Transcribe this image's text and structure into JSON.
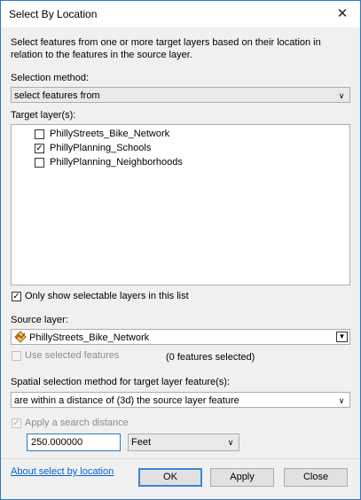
{
  "window": {
    "title": "Select By Location"
  },
  "description": "Select features from one or more target layers based on their location in relation to the features in the source layer.",
  "selection_method": {
    "label": "Selection method:",
    "value": "select features from"
  },
  "target_layers": {
    "label": "Target layer(s):",
    "items": [
      {
        "label": "PhillyStreets_Bike_Network",
        "checked": false
      },
      {
        "label": "PhillyPlanning_Schools",
        "checked": true
      },
      {
        "label": "PhillyPlanning_Neighborhoods",
        "checked": false
      }
    ]
  },
  "only_selectable": {
    "label": "Only show selectable layers in this list",
    "checked": true
  },
  "source_layer": {
    "label": "Source layer:",
    "value": "PhillyStreets_Bike_Network",
    "icon": "polyline-layer-icon"
  },
  "use_selected": {
    "label": "Use selected features",
    "checked": false,
    "count_text": "(0 features selected)"
  },
  "spatial_method": {
    "label": "Spatial selection method for target layer feature(s):",
    "value": "are within a distance of (3d) the source layer feature"
  },
  "search_distance": {
    "label": "Apply a search distance",
    "checked": true,
    "value": "250.000000",
    "unit": "Feet"
  },
  "footer": {
    "about_link": "About select by location",
    "ok": "OK",
    "apply": "Apply",
    "close": "Close"
  }
}
